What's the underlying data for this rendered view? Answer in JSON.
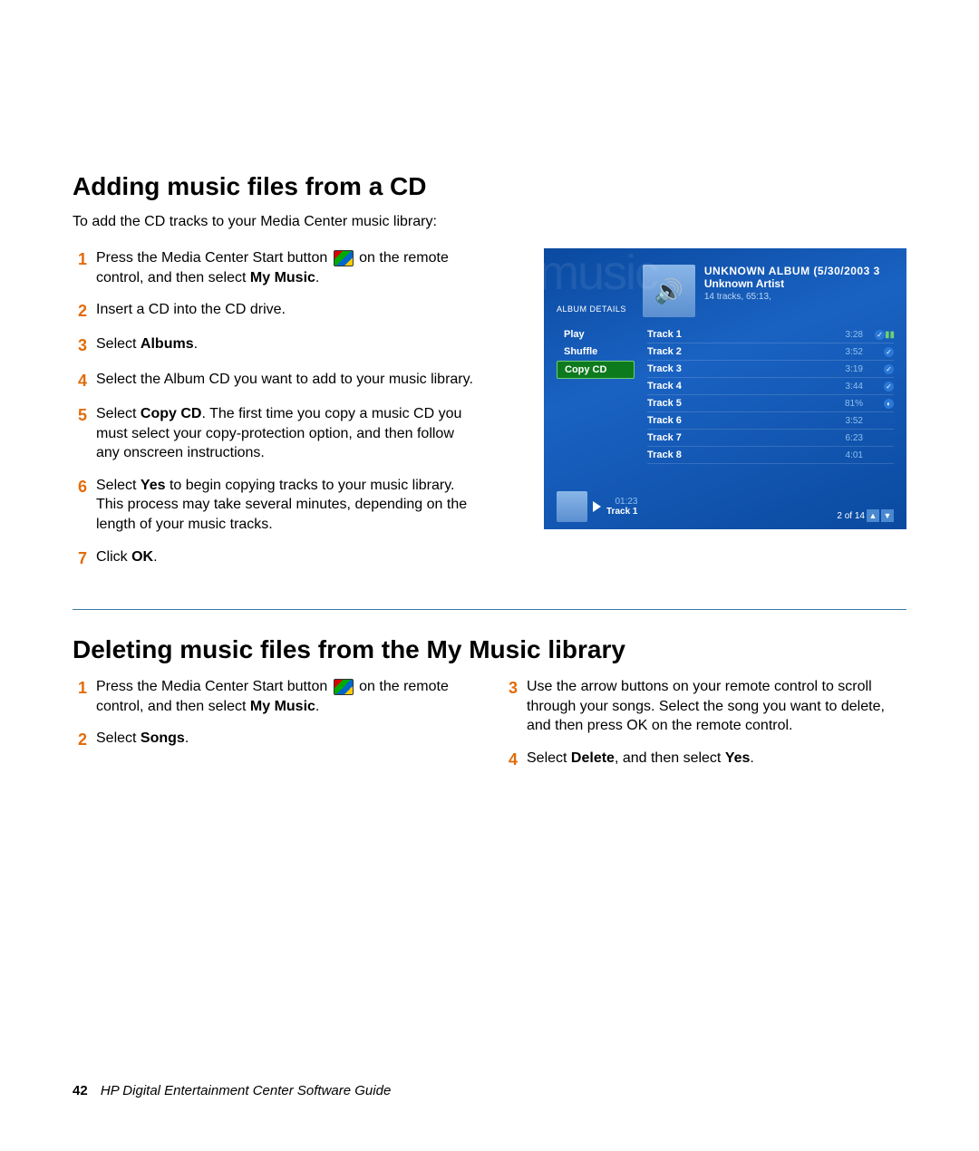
{
  "section1": {
    "heading": "Adding music files from a CD",
    "intro": "To add the CD tracks to your Media Center music library:",
    "steps": [
      {
        "num": "1",
        "before": "Press the Media Center Start button ",
        "after": " on the remote control, and then select ",
        "bold": "My Music",
        "trail": ".",
        "hasIcon": true
      },
      {
        "num": "2",
        "text": "Insert a CD into the CD drive."
      },
      {
        "num": "3",
        "before": "Select ",
        "bold": "Albums",
        "trail": "."
      },
      {
        "num": "4",
        "text": "Select the Album CD you want to add to your music library."
      },
      {
        "num": "5",
        "before": "Select ",
        "bold": "Copy CD",
        "trail": ". The first time you copy a music CD you must select your copy-protection option, and then follow any onscreen instructions."
      },
      {
        "num": "6",
        "before": "Select ",
        "bold": "Yes",
        "trail": " to begin copying tracks to your music library. This process may take several minutes, depending on the length of your music tracks."
      },
      {
        "num": "7",
        "before": "Click ",
        "bold": "OK",
        "trail": "."
      }
    ]
  },
  "screenshot": {
    "bgWord": "music",
    "albumDetailsLabel": "ALBUM DETAILS",
    "albumTitle": "UNKNOWN ALBUM (5/30/2003 3",
    "albumArtist": "Unknown Artist",
    "albumMeta": "14 tracks, 65:13,",
    "menu": [
      {
        "label": "Play",
        "selected": false
      },
      {
        "label": "Shuffle",
        "selected": false
      },
      {
        "label": "Copy CD",
        "selected": true
      }
    ],
    "tracks": [
      {
        "name": "Track 1",
        "dur": "3:28",
        "check": true,
        "bars": true
      },
      {
        "name": "Track 2",
        "dur": "3:52",
        "check": true
      },
      {
        "name": "Track 3",
        "dur": "3:19",
        "check": true
      },
      {
        "name": "Track 4",
        "dur": "3:44",
        "check": true
      },
      {
        "name": "Track 5",
        "dur": "81%",
        "spin": true
      },
      {
        "name": "Track 6",
        "dur": "3:52"
      },
      {
        "name": "Track 7",
        "dur": "6:23"
      },
      {
        "name": "Track 8",
        "dur": "4:01"
      }
    ],
    "nowTime": "01:23",
    "nowTrack": "Track 1",
    "pager": "2 of 14"
  },
  "section2": {
    "heading": "Deleting music files from the My Music library",
    "leftSteps": [
      {
        "num": "1",
        "before": "Press the Media Center Start button ",
        "after": " on the remote control, and then select ",
        "bold": "My Music",
        "trail": ".",
        "hasIcon": true
      },
      {
        "num": "2",
        "before": "Select ",
        "bold": "Songs",
        "trail": "."
      }
    ],
    "rightSteps": [
      {
        "num": "3",
        "text": "Use the arrow buttons on your remote control to scroll through your songs. Select the song you want to delete, and then press OK on the remote control."
      },
      {
        "num": "4",
        "before": "Select ",
        "bold": "Delete",
        "mid": ", and then select ",
        "bold2": "Yes",
        "trail": "."
      }
    ]
  },
  "footer": {
    "pageNum": "42",
    "title": "HP Digital Entertainment Center Software Guide"
  }
}
